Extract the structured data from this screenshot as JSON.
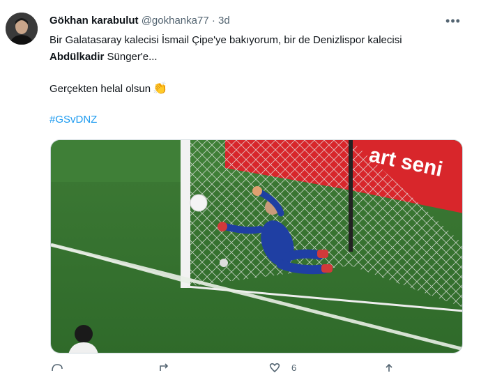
{
  "tweet": {
    "display_name": "Gökhan karabulut",
    "handle": "@gokhanka77",
    "separator": "·",
    "timestamp": "3d",
    "more_label": "•••",
    "text": {
      "line1": "Bir Galatasaray kalecisi İsmail Çipe'ye bakıyorum, bir de Denizlispor kalecisi",
      "line2_bold": "Abdülkadir",
      "line2_rest": " Sünger'e...",
      "paragraph2": "Gerçekten helal olsun",
      "emoji": "👏",
      "hashtag": "#GSvDNZ"
    },
    "media_icons": {
      "avatar": "profile-avatar-image",
      "media": "goalkeeper-dive-photo"
    },
    "actions": {
      "reply_icon": "reply-icon",
      "retweet_icon": "retweet-icon",
      "like_icon": "heart-icon",
      "like_count": "6",
      "share_icon": "share-icon"
    },
    "colors": {
      "link": "#1d9bf0",
      "secondary_text": "#536471"
    }
  }
}
